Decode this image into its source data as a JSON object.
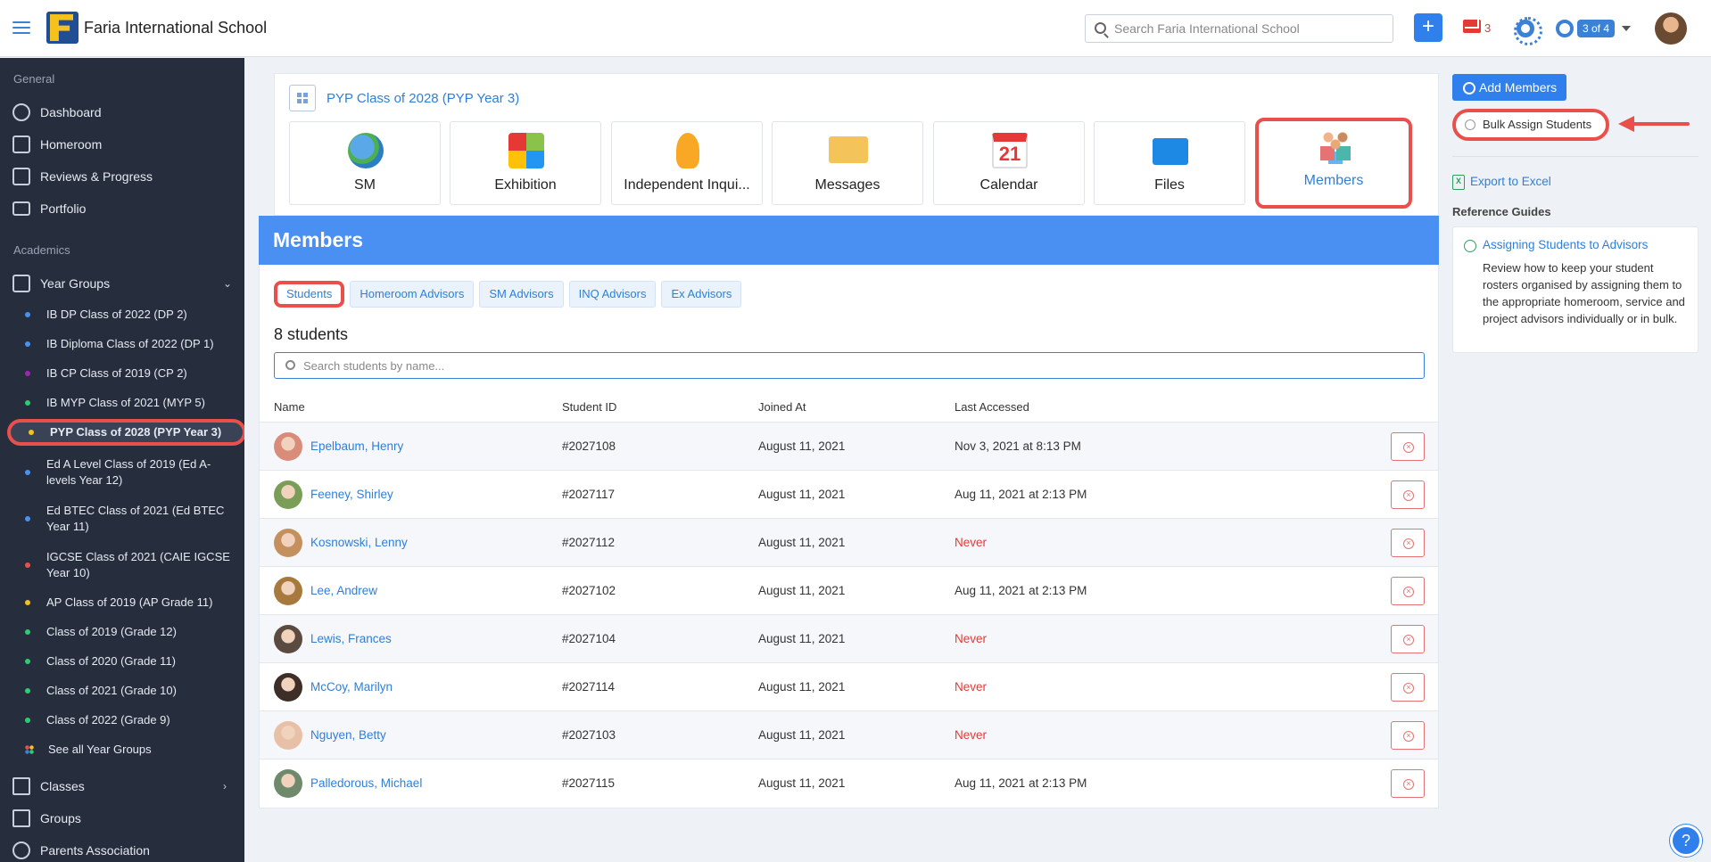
{
  "header": {
    "school_name": "Faria International School",
    "search_placeholder": "Search Faria International School",
    "add_label": "+",
    "mail_count": "3",
    "page_indicator": "3 of 4"
  },
  "sidebar": {
    "section_general": "General",
    "general_items": [
      "Dashboard",
      "Homeroom",
      "Reviews & Progress",
      "Portfolio"
    ],
    "section_academics": "Academics",
    "year_groups_label": "Year Groups",
    "year_groups": [
      {
        "label": "IB DP Class of 2022 (DP 2)",
        "color": "#4a90f2"
      },
      {
        "label": "IB Diploma Class of 2022 (DP 1)",
        "color": "#4a90f2"
      },
      {
        "label": "IB CP Class of 2019 (CP 2)",
        "color": "#9c27b0"
      },
      {
        "label": "IB MYP Class of 2021 (MYP 5)",
        "color": "#2ecc71"
      },
      {
        "label": "PYP Class of 2028 (PYP Year 3)",
        "color": "#f4c21b"
      },
      {
        "label": "Ed A Level Class of 2019 (Ed A-levels Year 12)",
        "color": "#4a90f2"
      },
      {
        "label": "Ed BTEC Class of 2021 (Ed BTEC Year 11)",
        "color": "#4a90f2"
      },
      {
        "label": "IGCSE Class of 2021 (CAIE IGCSE Year 10)",
        "color": "#e9504b"
      },
      {
        "label": "AP Class of 2019 (AP Grade 11)",
        "color": "#f4c21b"
      },
      {
        "label": "Class of 2019 (Grade 12)",
        "color": "#2ecc71"
      },
      {
        "label": "Class of 2020 (Grade 11)",
        "color": "#2ecc71"
      },
      {
        "label": "Class of 2021 (Grade 10)",
        "color": "#2ecc71"
      },
      {
        "label": "Class of 2022 (Grade 9)",
        "color": "#2ecc71"
      }
    ],
    "see_all_label": "See all Year Groups",
    "classes_label": "Classes",
    "groups_label": "Groups",
    "parents_label": "Parents Association"
  },
  "class_header": {
    "title": "PYP Class of 2028 (PYP Year 3)",
    "tiles": [
      "SM",
      "Exhibition",
      "Independent Inqui...",
      "Messages",
      "Calendar",
      "Files",
      "Members"
    ],
    "calendar_day": "21"
  },
  "members": {
    "title": "Members",
    "tabs": [
      "Students",
      "Homeroom Advisors",
      "SM Advisors",
      "INQ Advisors",
      "Ex Advisors"
    ],
    "count_label": "8 students",
    "search_placeholder": "Search students by name...",
    "columns": [
      "Name",
      "Student ID",
      "Joined At",
      "Last Accessed"
    ],
    "rows": [
      {
        "name": "Epelbaum, Henry",
        "id": "#2027108",
        "joined": "August 11, 2021",
        "last": "Nov 3, 2021 at 8:13 PM",
        "never": false
      },
      {
        "name": "Feeney, Shirley",
        "id": "#2027117",
        "joined": "August 11, 2021",
        "last": "Aug 11, 2021 at 2:13 PM",
        "never": false
      },
      {
        "name": "Kosnowski, Lenny",
        "id": "#2027112",
        "joined": "August 11, 2021",
        "last": "Never",
        "never": true
      },
      {
        "name": "Lee, Andrew",
        "id": "#2027102",
        "joined": "August 11, 2021",
        "last": "Aug 11, 2021 at 2:13 PM",
        "never": false
      },
      {
        "name": "Lewis, Frances",
        "id": "#2027104",
        "joined": "August 11, 2021",
        "last": "Never",
        "never": true
      },
      {
        "name": "McCoy, Marilyn",
        "id": "#2027114",
        "joined": "August 11, 2021",
        "last": "Never",
        "never": true
      },
      {
        "name": "Nguyen, Betty",
        "id": "#2027103",
        "joined": "August 11, 2021",
        "last": "Never",
        "never": true
      },
      {
        "name": "Palledorous, Michael",
        "id": "#2027115",
        "joined": "August 11, 2021",
        "last": "Aug 11, 2021 at 2:13 PM",
        "never": false
      }
    ]
  },
  "right_panel": {
    "add_members": "Add Members",
    "bulk_assign": "Bulk Assign Students",
    "export_excel": "Export to Excel",
    "reference_title": "Reference Guides",
    "guide_title": "Assigning Students to Advisors",
    "guide_desc": "Review how to keep your student rosters organised by assigning them to the appropriate homeroom, service and project advisors individually or in bulk."
  },
  "help_label": "?"
}
